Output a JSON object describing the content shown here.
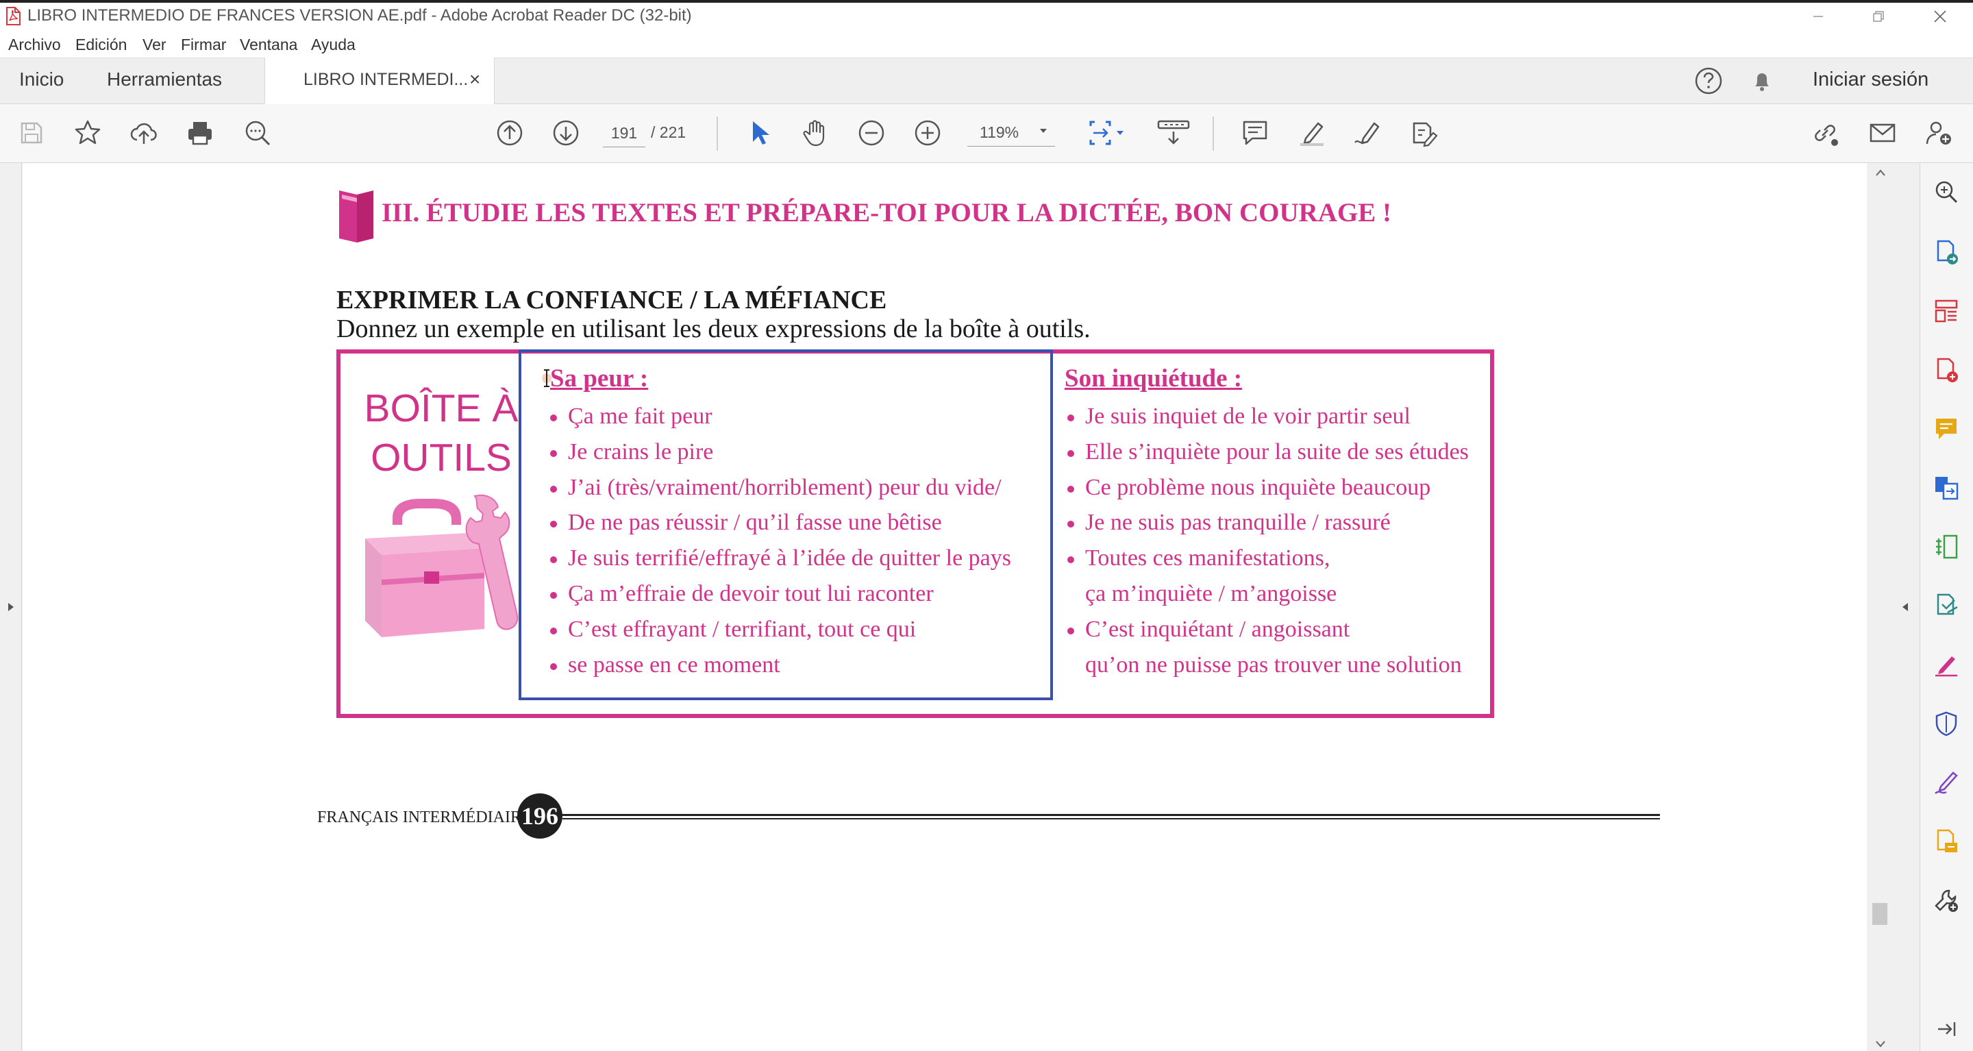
{
  "window": {
    "title": "LIBRO INTERMEDIO DE FRANCES VERSION AE.pdf - Adobe Acrobat Reader DC (32-bit)"
  },
  "menu": {
    "items": [
      "Archivo",
      "Edición",
      "Ver",
      "Firmar",
      "Ventana",
      "Ayuda"
    ]
  },
  "tabs": {
    "home": "Inicio",
    "tools": "Herramientas",
    "document": "LIBRO INTERMEDI...",
    "close_glyph": "×"
  },
  "account": {
    "sign_in": "Iniciar sesión"
  },
  "toolbar": {
    "current_page": "191",
    "total_pages": "/  221",
    "zoom": "119%"
  },
  "document": {
    "section_title": "III. ÉTUDIE LES TEXTES ET PRÉPARE-TOI POUR LA DICTÉE, BON COURAGE !",
    "subsection_title": "EXPRIMER LA CONFIANCE / LA MÉFIANCE",
    "instruction": "Donnez un exemple en utilisant les deux expressions de la boîte à outils.",
    "toolbox_label_line1": "BOÎTE À",
    "toolbox_label_line2": "OUTILS",
    "columns": [
      {
        "heading": "Sa peur :",
        "items": [
          {
            "text": "Ça me fait peur",
            "bullet": true
          },
          {
            "text": "Je crains le pire",
            "bullet": true
          },
          {
            "text": "J’ai (très/vraiment/horriblement) peur du vide/",
            "bullet": true
          },
          {
            "text": "De ne pas réussir / qu’il fasse une bêtise",
            "bullet": true
          },
          {
            "text": "Je suis terrifié/effrayé à l’idée de quitter le pays",
            "bullet": true
          },
          {
            "text": "Ça m’effraie de devoir tout lui raconter",
            "bullet": true
          },
          {
            "text": "C’est effrayant / terrifiant, tout ce qui",
            "bullet": true
          },
          {
            "text": "se passe en ce moment",
            "bullet": true
          }
        ]
      },
      {
        "heading": "Son inquiétude :",
        "items": [
          {
            "text": "Je suis inquiet de le voir partir seul",
            "bullet": true
          },
          {
            "text": "Elle s’inquiète pour la suite de ses études",
            "bullet": true
          },
          {
            "text": "Ce problème nous inquiète beaucoup",
            "bullet": true
          },
          {
            "text": "Je ne suis pas tranquille / rassuré",
            "bullet": true
          },
          {
            "text": "Toutes ces manifestations,",
            "bullet": true
          },
          {
            "text": "ça m’inquiète / m’angoisse",
            "bullet": false
          },
          {
            "text": "C’est inquiétant / angoissant",
            "bullet": true
          },
          {
            "text": "qu’on ne puisse pas trouver une solution",
            "bullet": false
          }
        ]
      }
    ],
    "footer_label": "FRANÇAIS INTERMÉDIAIRE",
    "page_number": "196"
  },
  "colors": {
    "accent_pink": "#d2338a",
    "box_blue": "#3a4fb0",
    "toolbar_blue": "#2d6bd1"
  },
  "icons": {
    "toolbar": [
      "save-icon",
      "bookmark-star-icon",
      "upload-cloud-icon",
      "print-icon",
      "find-icon",
      "previous-page-icon",
      "next-page-icon",
      "select-arrow-icon",
      "hand-icon",
      "zoom-out-icon",
      "zoom-in-icon",
      "fit-page-icon",
      "scroll-mode-icon",
      "comment-icon",
      "highlight-icon",
      "draw-icon",
      "edit-text-icon",
      "share-link-icon",
      "email-icon",
      "add-user-icon"
    ],
    "right_pane": [
      "zoom-icon",
      "export-pdf-icon",
      "organize-pages-icon",
      "create-pdf-icon",
      "comment-tool-icon",
      "combine-files-icon",
      "compress-icon",
      "send-for-review-icon",
      "fill-sign-icon",
      "protect-icon",
      "sign-icon",
      "stamp-icon",
      "more-tools-icon"
    ]
  }
}
